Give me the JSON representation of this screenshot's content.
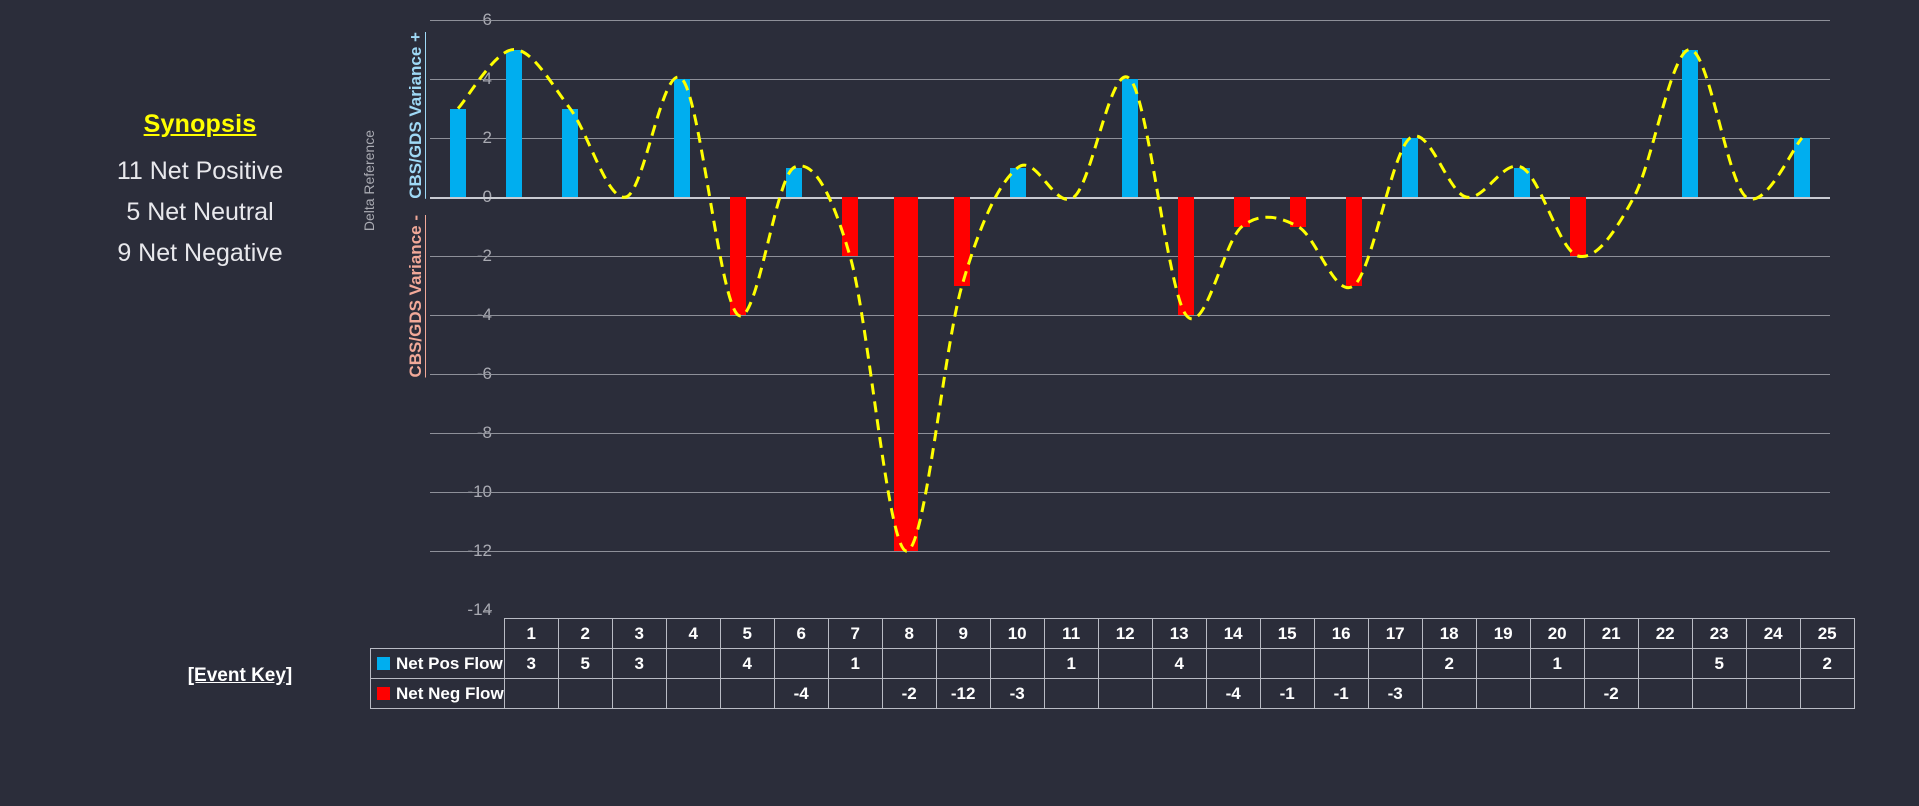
{
  "synopsis": {
    "title": "Synopsis",
    "lines": [
      "11 Net Positive",
      "5 Net Neutral",
      "9 Net Negative"
    ]
  },
  "event_key_label": "[Event Key]",
  "axis": {
    "delta_reference": "Delta Reference",
    "positive_title": "CBS/GDS Variance +",
    "negative_title": "CBS/GDS Variance -"
  },
  "colors": {
    "background": "#2B2D3A",
    "positive_bar": "#00AEEF",
    "negative_bar": "#FF0000",
    "spline": "#FFFF00",
    "gridline": "#8E9099",
    "zeroline": "#C9CBD2",
    "accent_title": "#FFFF00"
  },
  "table": {
    "header_row_label": "",
    "rows": [
      {
        "label": "Net Pos Flow",
        "swatch": "pos"
      },
      {
        "label": "Net Neg Flow",
        "swatch": "neg"
      }
    ]
  },
  "chart_data": {
    "type": "bar",
    "title": "",
    "xlabel": "",
    "ylabel": "Delta Reference",
    "ylim": [
      -14,
      6
    ],
    "yticks": [
      6,
      4,
      2,
      0,
      -2,
      -4,
      -6,
      -8,
      -10,
      -12,
      -14
    ],
    "grid": true,
    "legend_position": "bottom-table",
    "categories": [
      "1",
      "2",
      "3",
      "4",
      "5",
      "6",
      "7",
      "8",
      "9",
      "10",
      "11",
      "12",
      "13",
      "14",
      "15",
      "16",
      "17",
      "18",
      "19",
      "20",
      "21",
      "22",
      "23",
      "24",
      "25"
    ],
    "series": [
      {
        "name": "Net Pos Flow",
        "color": "#00AEEF",
        "values": [
          3,
          5,
          3,
          null,
          4,
          null,
          1,
          null,
          null,
          null,
          1,
          null,
          4,
          null,
          null,
          null,
          null,
          2,
          null,
          1,
          null,
          null,
          5,
          null,
          2
        ],
        "display": [
          "3",
          "5",
          "3",
          "",
          "4",
          "",
          "1",
          "",
          "",
          "",
          "1",
          "",
          "4",
          "",
          "",
          "",
          "",
          "2",
          "",
          "1",
          "",
          "",
          "5",
          "",
          "2"
        ]
      },
      {
        "name": "Net Neg Flow",
        "color": "#FF0000",
        "values": [
          null,
          null,
          null,
          null,
          null,
          -4,
          null,
          -2,
          -12,
          -3,
          null,
          null,
          null,
          -4,
          -1,
          -1,
          -3,
          null,
          null,
          null,
          -2,
          null,
          null,
          null,
          null
        ],
        "display": [
          "",
          "",
          "",
          "",
          "",
          "-4",
          "",
          "-2",
          "-12",
          "-3",
          "",
          "",
          "",
          "-4",
          "-1",
          "-1",
          "-3",
          "",
          "",
          "",
          "-2",
          "",
          "",
          "",
          ""
        ]
      }
    ],
    "net_values": [
      3,
      5,
      3,
      0,
      4,
      -4,
      1,
      -2,
      -12,
      -3,
      1,
      0,
      4,
      -4,
      -1,
      -1,
      -3,
      2,
      0,
      1,
      -2,
      0,
      5,
      0,
      2
    ],
    "spline": {
      "name": "Smoothed net trend",
      "style": "dashed",
      "color": "#FFFF00"
    }
  }
}
